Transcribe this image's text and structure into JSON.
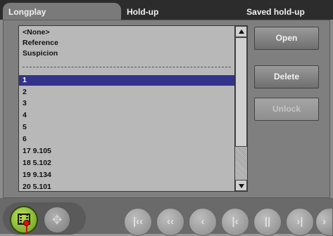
{
  "tabs": [
    {
      "label": "Longplay"
    },
    {
      "label": "Hold-up"
    },
    {
      "label": "Saved hold-up"
    }
  ],
  "list": {
    "items": [
      {
        "label": "<None>"
      },
      {
        "label": "Reference"
      },
      {
        "label": "Suspicion"
      },
      {
        "label": "1",
        "selected": true
      },
      {
        "label": "2"
      },
      {
        "label": "3"
      },
      {
        "label": "4"
      },
      {
        "label": "5"
      },
      {
        "label": "6"
      },
      {
        "label": "17 9.105"
      },
      {
        "label": "18 5.102"
      },
      {
        "label": "19 9.134"
      },
      {
        "label": "20 5.101"
      }
    ],
    "selected_color": "#33338c"
  },
  "buttons": {
    "open": "Open",
    "delete": "Delete",
    "unlock": "Unlock"
  },
  "bottom": {
    "modes": [
      {
        "icon": "film-icon",
        "active": true,
        "color": "#8bbd32"
      },
      {
        "icon": "navigation-cross-icon",
        "active": false
      }
    ],
    "transport_icons": [
      "skip-to-start-icon",
      "rewind-icon",
      "step-back-icon",
      "previous-frame-icon",
      "pause-icon",
      "next-frame-icon",
      "forward-icon"
    ]
  }
}
